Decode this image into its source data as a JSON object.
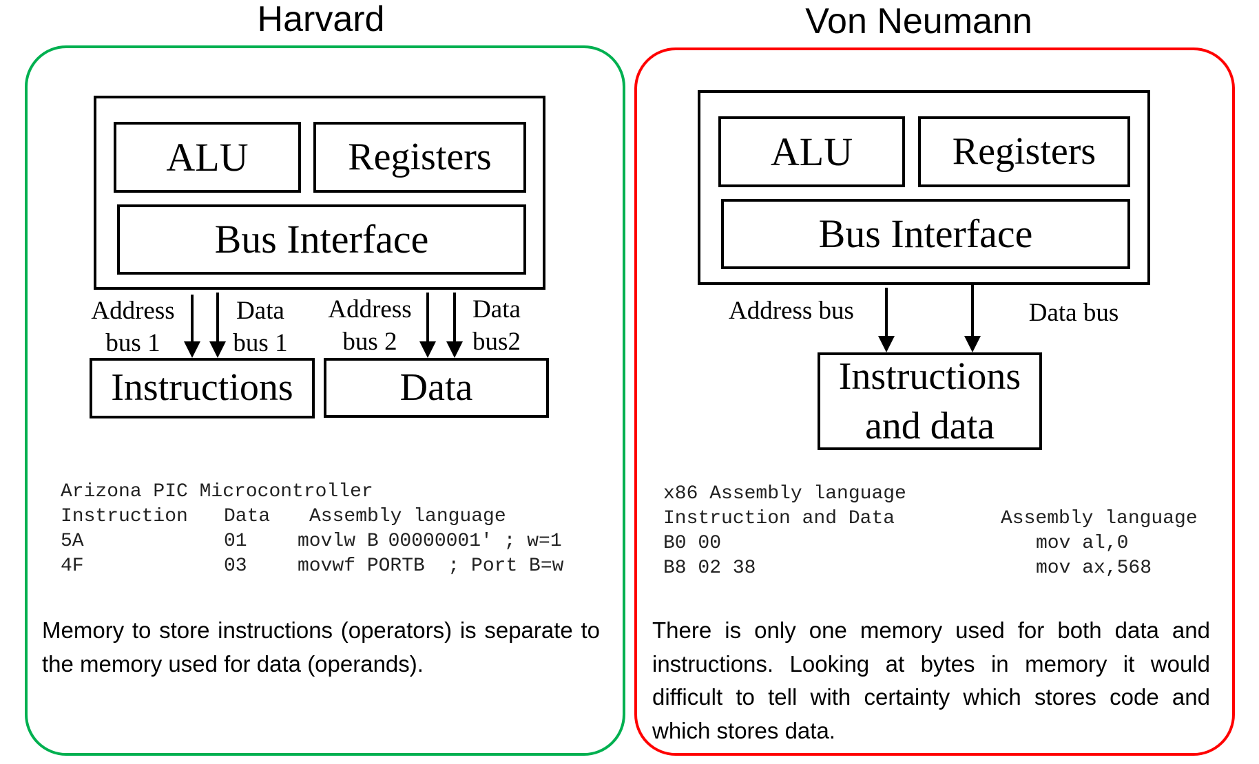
{
  "harvard": {
    "title": "Harvard",
    "border_color": "#00b050",
    "cpu": {
      "alu": "ALU",
      "registers": "Registers",
      "bus_interface": "Bus Interface"
    },
    "bus_labels": [
      "Address\nbus 1",
      "Data\nbus 1",
      "Address\nbus 2",
      "Data\nbus2"
    ],
    "memories": [
      "Instructions",
      "Data"
    ],
    "code": {
      "title": "Arizona PIC Microcontroller",
      "headers": [
        "Instruction",
        "Data",
        "Assembly language"
      ],
      "rows": [
        [
          "5A",
          "01",
          "movlw B 00000001′ ; w=1"
        ],
        [
          "4F",
          "03",
          "movwf PORTB  ; Port B=w"
        ]
      ]
    },
    "description": "Memory to store instructions (operators) is separate to the memory used for data (operands)."
  },
  "von_neumann": {
    "title": "Von Neumann",
    "border_color": "#ff0000",
    "cpu": {
      "alu": "ALU",
      "registers": "Registers",
      "bus_interface": "Bus Interface"
    },
    "bus_labels": [
      "Address bus",
      "Data bus"
    ],
    "memory": "Instructions and data",
    "code": {
      "title": "x86 Assembly language",
      "headers": [
        "Instruction and Data",
        "Assembly language"
      ],
      "rows": [
        [
          "B0 00",
          "mov al,0"
        ],
        [
          "B8 02 38",
          "mov ax,568"
        ]
      ]
    },
    "description": "There is only one memory used for both data and instructions.  Looking at bytes in memory it would difficult to tell with certainty which stores code and which stores data."
  }
}
